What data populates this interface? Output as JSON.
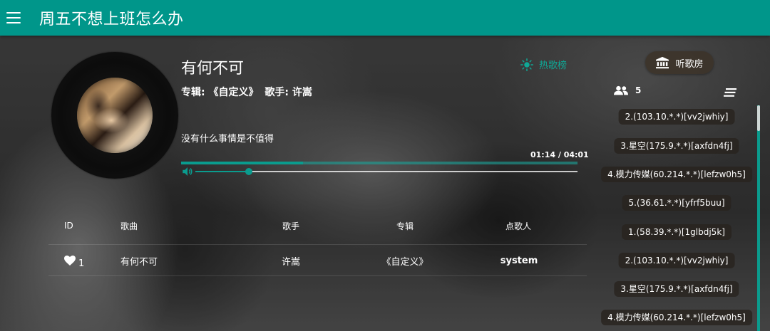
{
  "app": {
    "title": "周五不想上班怎么办"
  },
  "player": {
    "song_title": "有何不可",
    "album_line": "专辑: 《自定义》",
    "singer_line": "歌手: 许嵩",
    "lyric": "没有什么事情是不值得",
    "time": "01:14 / 04:01",
    "progress_fraction": 0.307,
    "volume_fraction": 0.14
  },
  "links": {
    "hot_list": "热歌榜",
    "room": "听歌房"
  },
  "table": {
    "headers": {
      "id": "ID",
      "song": "歌曲",
      "singer": "歌手",
      "album": "专辑",
      "user": "点歌人"
    },
    "rows": [
      {
        "id": "1",
        "song": "有何不可",
        "singer": "许嵩",
        "album": "《自定义》",
        "user": "system"
      }
    ]
  },
  "room_panel": {
    "online_count": "5",
    "users": [
      "2.(103.10.*.*)[vv2jwhiy]",
      "3.星空(175.9.*.*)[axfdn4fj]",
      "4.模力传媒(60.214.*.*)[lefzw0h5]",
      "5.(36.61.*.*)[yfrf5buu]",
      "1.(58.39.*.*)[1glbdj5k]",
      "2.(103.10.*.*)[vv2jwhiy]",
      "3.星空(175.9.*.*)[axfdn4fj]",
      "4.模力传媒(60.214.*.*)[lefzw0h5]"
    ]
  },
  "colors": {
    "accent": "#00968a",
    "hot_link": "#0fa896"
  }
}
